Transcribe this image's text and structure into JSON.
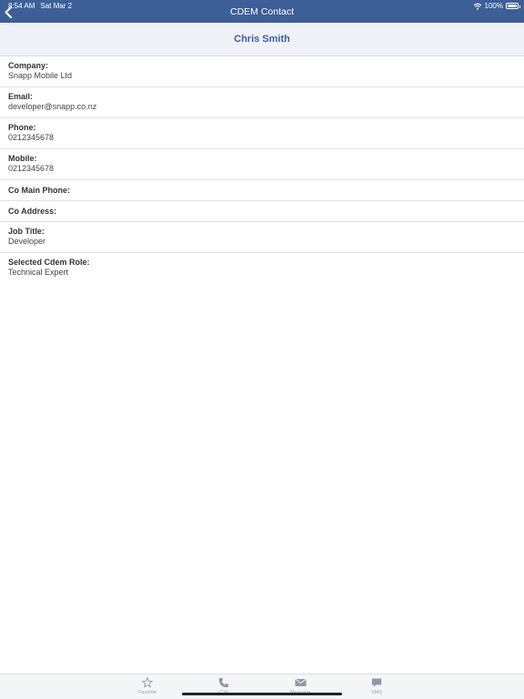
{
  "status": {
    "time": "8:54 AM",
    "date": "Sat Mar 2",
    "battery": "100%"
  },
  "navbar": {
    "title": "CDEM Contact"
  },
  "contact": {
    "name": "Chris Smith"
  },
  "fields": [
    {
      "label": "Company:",
      "value": "Snapp Mobile Ltd"
    },
    {
      "label": "Email:",
      "value": "developer@snapp.co.nz"
    },
    {
      "label": "Phone:",
      "value": "0212345678"
    },
    {
      "label": "Mobile:",
      "value": "0212345678"
    },
    {
      "label": "Co Main Phone:",
      "value": ""
    },
    {
      "label": "Co Address:",
      "value": ""
    },
    {
      "label": "Job Title:",
      "value": "Developer"
    },
    {
      "label": "Selected Cdem Role:",
      "value": "Technical Expert"
    }
  ],
  "tabbar": {
    "items": [
      {
        "label": "Favorite",
        "icon": "star-icon"
      },
      {
        "label": "Call",
        "icon": "phone-icon"
      },
      {
        "label": "Message",
        "icon": "envelope-icon"
      },
      {
        "label": "SMS",
        "icon": "chat-bubble-icon"
      }
    ]
  },
  "colors": {
    "nav_bg": "#3d5f97",
    "header_bg": "#eef1f6",
    "tab_icon": "#8e9aab"
  }
}
